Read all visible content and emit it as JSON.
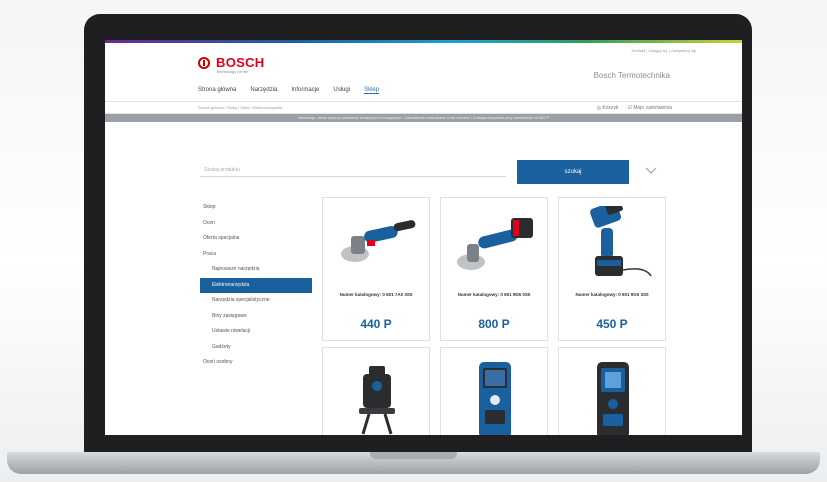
{
  "brand": {
    "logo_text": "BOSCH",
    "logo_subtitle": "Technology for life",
    "site_name": "Bosch Termotechnika",
    "top_links": "Kontakt | Zaloguj się | Zarejestruj się"
  },
  "nav": {
    "items": [
      {
        "label": "Strona główna"
      },
      {
        "label": "Narzędzia"
      },
      {
        "label": "Informacje"
      },
      {
        "label": "Usługi"
      },
      {
        "label": "Sklep",
        "active": true
      }
    ]
  },
  "breadcrumb": {
    "text": "Strona główna  /  Sklep  /  Ofert  /  Elektronarzędzia",
    "cart_label": "Koszyk",
    "wishlist_label": "Moje zamówienia"
  },
  "banner": {
    "text": "Informacja: oferta dotyczy produktów dostępnych w magazynie   •   Zamówienia realizowane w dni robocze   •   Dostawa bezpłatna przy zamówieniu od 800 P"
  },
  "search": {
    "placeholder": "Szukaj produktu",
    "button_label": "szukaj"
  },
  "sidebar": {
    "items": [
      {
        "label": "Sklep",
        "level": 0
      },
      {
        "label": "Ocen",
        "level": 0
      },
      {
        "label": "Oferta specjalna",
        "level": 0
      },
      {
        "label": "Praca",
        "level": 0
      },
      {
        "label": "Najnowsze narzędzia",
        "level": 1
      },
      {
        "label": "Elektronarzędzia",
        "level": 1,
        "active": true
      },
      {
        "label": "Narzędzia specjalistyczne",
        "level": 1
      },
      {
        "label": "Biny zasięgowe",
        "level": 1
      },
      {
        "label": "Ustawie niwelacji",
        "level": 1
      },
      {
        "label": "Gadżety",
        "level": 1
      },
      {
        "label": "Oceń osobny",
        "level": 0
      }
    ]
  },
  "products": [
    {
      "icon": "angle-grinder-icon",
      "name": "Numer katalogowy: 0 601 7A0 3S0",
      "price": "440 P"
    },
    {
      "icon": "cordless-angle-grinder-icon",
      "name": "Numer katalogowy: 0 601 9D6 0S0",
      "price": "800 P"
    },
    {
      "icon": "impact-wrench-icon",
      "name": "Numer katalogowy: 0 601 9G0 3S0",
      "price": "450 P"
    },
    {
      "icon": "line-laser-icon",
      "name": "",
      "price": ""
    },
    {
      "icon": "laser-rangefinder-icon",
      "name": "",
      "price": ""
    },
    {
      "icon": "digital-measure-icon",
      "name": "",
      "price": ""
    }
  ],
  "colors": {
    "accent": "#1a5f9e",
    "brand_red": "#e2001a",
    "banner": "#9aa0a6"
  }
}
